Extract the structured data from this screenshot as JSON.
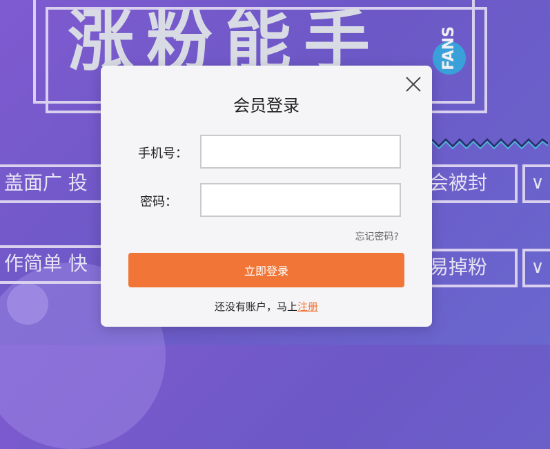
{
  "background": {
    "hero_title": "涨粉能手",
    "fans_text": "FANS",
    "row1": {
      "left_text": "盖面广  投",
      "right_text": "会被封"
    },
    "row2": {
      "left_text": "作简单  快",
      "right_text": "易掉粉"
    },
    "chevron_glyph": "∨",
    "colors": {
      "frame": "#d8d0ee",
      "fans_circle": "#3aa0da"
    }
  },
  "modal": {
    "title": "会员登录",
    "close_glyph": "×",
    "phone_label": "手机号：",
    "phone_value": "",
    "phone_placeholder": "",
    "password_label": "密码：",
    "password_value": "",
    "password_placeholder": "",
    "forgot_link": "忘记密码?",
    "login_button": "立即登录",
    "register_prompt": "还没有账户，马上",
    "register_link": "注册",
    "colors": {
      "accent": "#f07536",
      "panel": "#f5f5f7"
    }
  }
}
